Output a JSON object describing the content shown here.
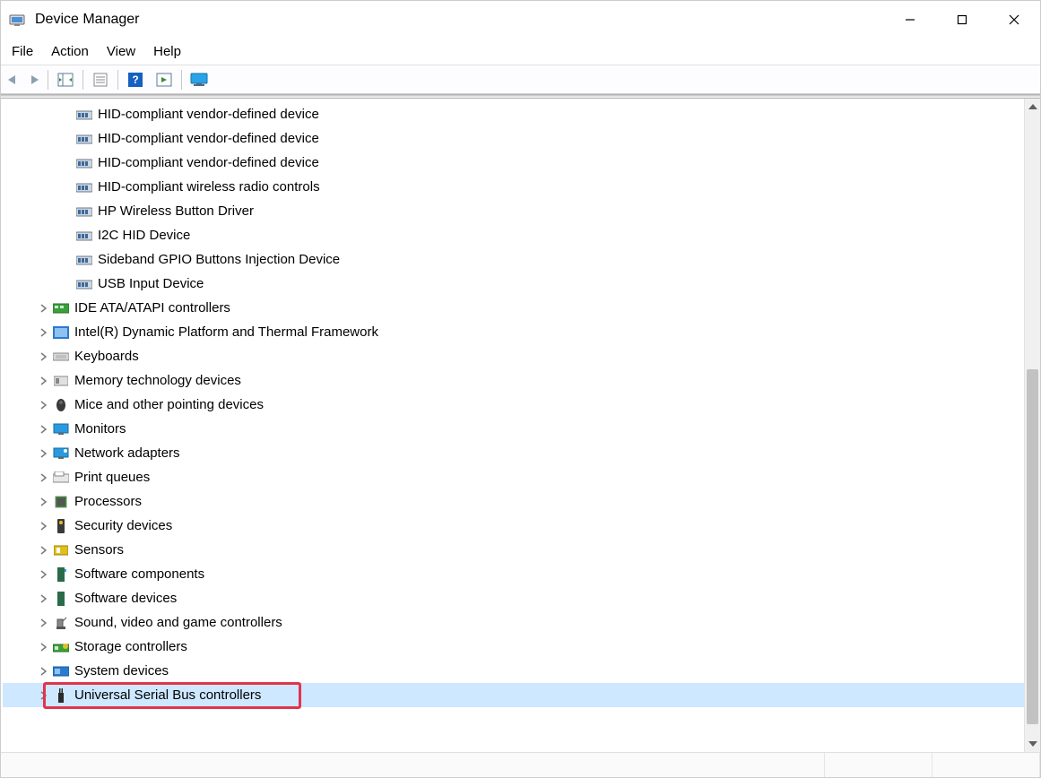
{
  "window": {
    "title": "Device Manager"
  },
  "menus": {
    "file": "File",
    "action": "Action",
    "view": "View",
    "help": "Help"
  },
  "tree": {
    "children": [
      "HID-compliant vendor-defined device",
      "HID-compliant vendor-defined device",
      "HID-compliant vendor-defined device",
      "HID-compliant wireless radio controls",
      "HP Wireless Button Driver",
      "I2C HID Device",
      "Sideband GPIO Buttons Injection Device",
      "USB Input Device"
    ],
    "categories": [
      "IDE ATA/ATAPI controllers",
      "Intel(R) Dynamic Platform and Thermal Framework",
      "Keyboards",
      "Memory technology devices",
      "Mice and other pointing devices",
      "Monitors",
      "Network adapters",
      "Print queues",
      "Processors",
      "Security devices",
      "Sensors",
      "Software components",
      "Software devices",
      "Sound, video and game controllers",
      "Storage controllers",
      "System devices",
      "Universal Serial Bus controllers"
    ],
    "highlighted_index": 16
  }
}
